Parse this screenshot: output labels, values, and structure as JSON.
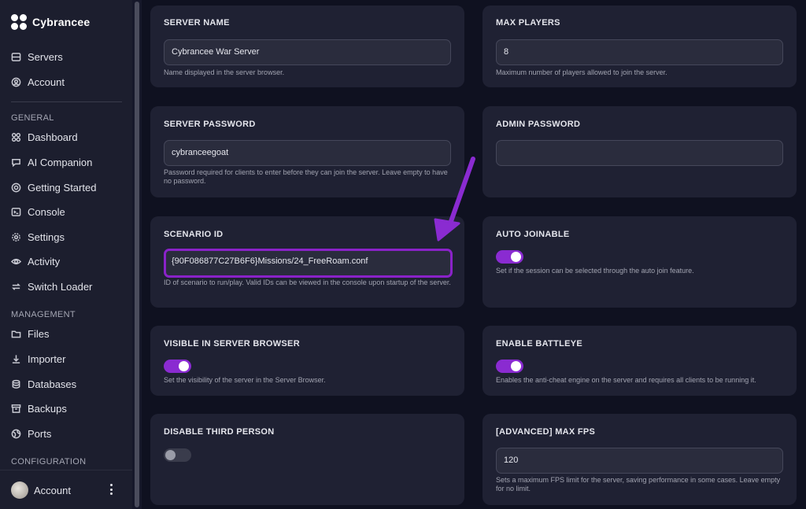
{
  "brand": {
    "name": "Cybrancee",
    "logo_icon": "four-dots-logo"
  },
  "nav_top": [
    {
      "label": "Servers",
      "icon": "server-icon"
    },
    {
      "label": "Account",
      "icon": "user-circle-icon"
    }
  ],
  "nav_general": {
    "heading": "GENERAL",
    "items": [
      {
        "label": "Dashboard",
        "icon": "grid-icon"
      },
      {
        "label": "AI Companion",
        "icon": "chat-icon"
      },
      {
        "label": "Getting Started",
        "icon": "lifebuoy-icon"
      },
      {
        "label": "Console",
        "icon": "terminal-icon"
      },
      {
        "label": "Settings",
        "icon": "gear-icon"
      },
      {
        "label": "Activity",
        "icon": "eye-icon"
      },
      {
        "label": "Switch Loader",
        "icon": "swap-icon"
      }
    ]
  },
  "nav_management": {
    "heading": "MANAGEMENT",
    "items": [
      {
        "label": "Files",
        "icon": "folder-icon"
      },
      {
        "label": "Importer",
        "icon": "download-icon"
      },
      {
        "label": "Databases",
        "icon": "database-icon"
      },
      {
        "label": "Backups",
        "icon": "archive-icon"
      },
      {
        "label": "Ports",
        "icon": "globe-icon"
      }
    ]
  },
  "nav_configuration": {
    "heading": "CONFIGURATION"
  },
  "footer": {
    "account_label": "Account"
  },
  "cards": {
    "server_name": {
      "title": "SERVER NAME",
      "value": "Cybrancee War Server",
      "help": "Name displayed in the server browser."
    },
    "max_players": {
      "title": "MAX PLAYERS",
      "value": "8",
      "help": "Maximum number of players allowed to join the server."
    },
    "server_password": {
      "title": "SERVER PASSWORD",
      "value": "cybranceegoat",
      "help": "Password required for clients to enter before they can join the server. Leave empty to have no password."
    },
    "admin_password": {
      "title": "ADMIN PASSWORD",
      "value": ""
    },
    "scenario_id": {
      "title": "SCENARIO ID",
      "value": "{90F086877C27B6F6}Missions/24_FreeRoam.conf",
      "help": "ID of scenario to run/play. Valid IDs can be viewed in the console upon startup of the server."
    },
    "auto_joinable": {
      "title": "AUTO JOINABLE",
      "enabled": true,
      "help": "Set if the session can be selected through the auto join feature."
    },
    "visible_in_browser": {
      "title": "VISIBLE IN SERVER BROWSER",
      "enabled": true,
      "help": "Set the visibility of the server in the Server Browser."
    },
    "enable_battleye": {
      "title": "ENABLE BATTLEYE",
      "enabled": true,
      "help": "Enables the anti-cheat engine on the server and requires all clients to be running it."
    },
    "disable_third_person": {
      "title": "DISABLE THIRD PERSON",
      "enabled": false
    },
    "max_fps": {
      "title": "[ADVANCED] MAX FPS",
      "value": "120",
      "help": "Sets a maximum FPS limit for the server, saving performance in some cases. Leave empty for no limit."
    }
  },
  "colors": {
    "accent": "#8a2bd1",
    "highlight": "#8a22c9",
    "card": "#1f2133",
    "sidebar": "#1c1e2e"
  }
}
